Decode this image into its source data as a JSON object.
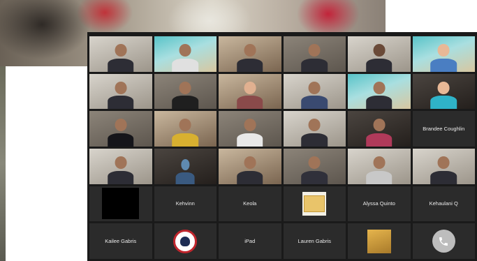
{
  "gallery": {
    "participants": [
      {
        "name": "Brandee Coughlin"
      },
      {
        "name": "Kehvinn"
      },
      {
        "name": "Keola"
      },
      {
        "name": "Alyssa Quinto"
      },
      {
        "name": "Kehaulani Q"
      },
      {
        "name": "Kailee Gabris"
      },
      {
        "name": "iPad"
      },
      {
        "name": "Lauren Gabris"
      }
    ]
  },
  "colors": {
    "tile_bg": "#2b2b2b",
    "gallery_bg": "#1a1a1a",
    "phone_button": "#bdbdbd"
  },
  "icons": {
    "call": "phone-icon"
  }
}
